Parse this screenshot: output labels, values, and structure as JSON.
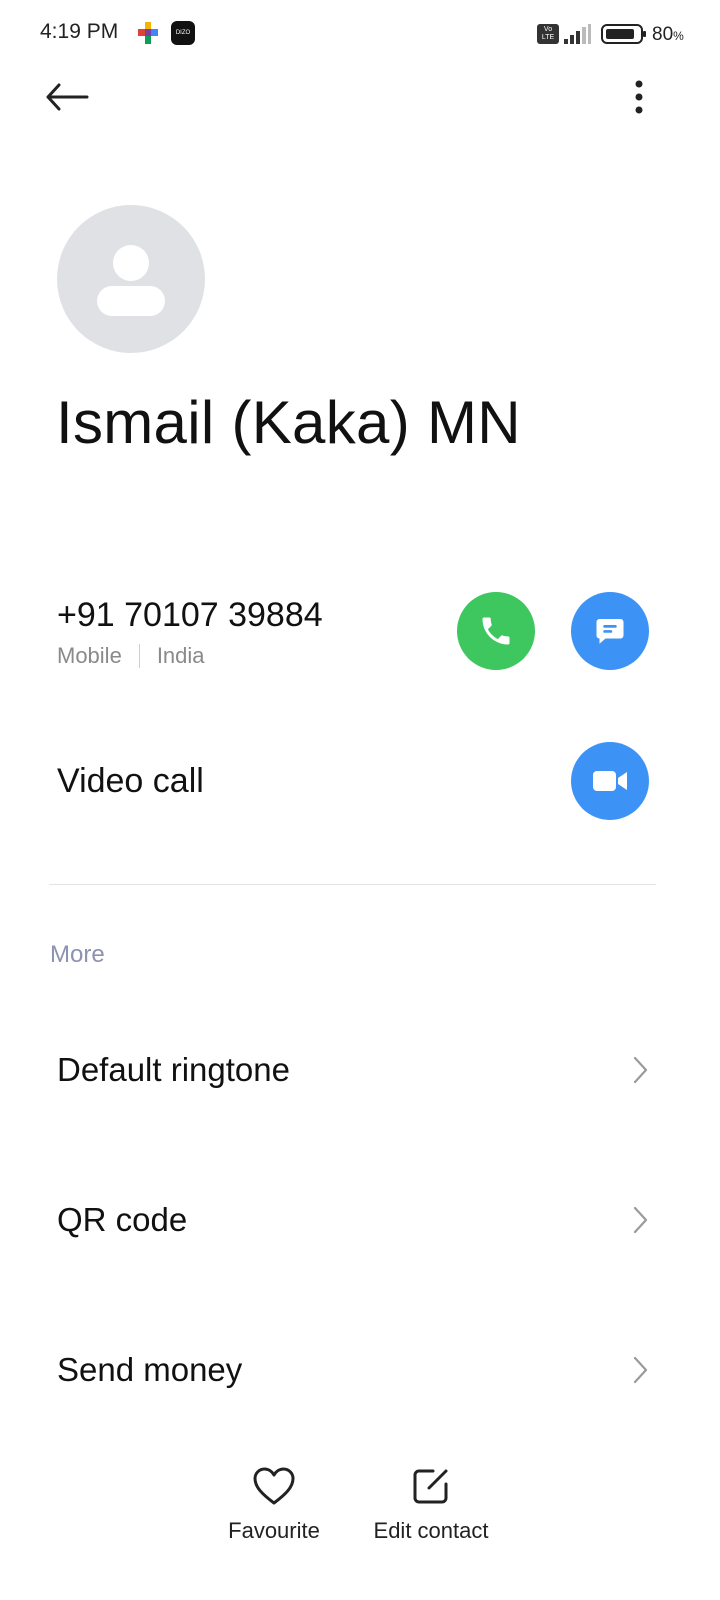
{
  "status_bar": {
    "time": "4:19 PM",
    "app_badge": "DIZO",
    "volte_label": "Vo\nLTE",
    "battery_percent": "80",
    "battery_unit": "%",
    "icons": [
      "multicolor-app-icon",
      "dizo-app-icon",
      "volte-icon",
      "signal-icon",
      "battery-icon"
    ]
  },
  "toolbar": {
    "back_icon": "arrow-left-icon",
    "more_icon": "more-vertical-icon"
  },
  "contact": {
    "name": "Ismail (Kaka) MN",
    "avatar_icon": "person-placeholder-icon",
    "phone": {
      "number": "+91 70107 39884",
      "type": "Mobile",
      "region": "India"
    },
    "video_call_label": "Video call"
  },
  "colors": {
    "call": "#3ec65f",
    "message": "#3d93f5",
    "video": "#3d93f5",
    "section_header": "#8d92b3",
    "avatar_bg": "#dfe1e5"
  },
  "more_section": {
    "header": "More",
    "items": [
      {
        "label": "Default ringtone"
      },
      {
        "label": "QR code"
      },
      {
        "label": "Send money"
      }
    ]
  },
  "bottom_bar": {
    "favourite_label": "Favourite",
    "edit_label": "Edit contact"
  }
}
